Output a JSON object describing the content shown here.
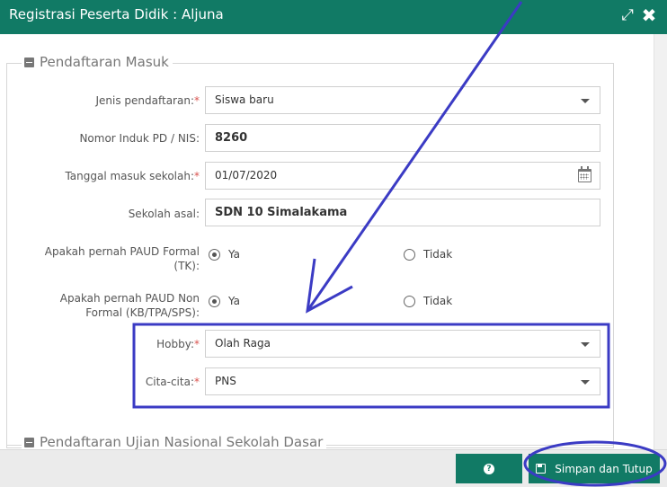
{
  "window": {
    "title": "Registrasi Peserta Didik : Aljuna",
    "expand_icon": "⤢",
    "close_icon": "✖"
  },
  "section1": {
    "legend": "Pendaftaran Masuk"
  },
  "section2": {
    "legend": "Pendaftaran Ujian Nasional Sekolah Dasar"
  },
  "fields": {
    "jenis": {
      "label": "Jenis pendaftaran:",
      "required": "*",
      "value": "Siswa baru"
    },
    "nis": {
      "label": "Nomor Induk PD / NIS:",
      "value": "8260"
    },
    "tanggal": {
      "label": "Tanggal masuk sekolah:",
      "required": "*",
      "value": "01/07/2020"
    },
    "sekolah": {
      "label": "Sekolah asal:",
      "value": "SDN 10 Simalakama"
    },
    "paud_formal": {
      "label_line1": "Apakah pernah PAUD Formal",
      "label_line2": "(TK):",
      "opt_yes": "Ya",
      "opt_no": "Tidak",
      "selected": "Ya"
    },
    "paud_nonformal": {
      "label_line1": "Apakah pernah PAUD Non",
      "label_line2": "Formal (KB/TPA/SPS):",
      "opt_yes": "Ya",
      "opt_no": "Tidak",
      "selected": "Ya"
    },
    "hobby": {
      "label": "Hobby:",
      "required": "*",
      "value": "Olah Raga"
    },
    "cita": {
      "label": "Cita-cita:",
      "required": "*",
      "value": "PNS"
    }
  },
  "footer": {
    "help_icon": "?",
    "save_label": "Simpan dan Tutup"
  },
  "colors": {
    "primary": "#117a65",
    "required": "#d9534f",
    "annotation": "#3b3bc4"
  }
}
